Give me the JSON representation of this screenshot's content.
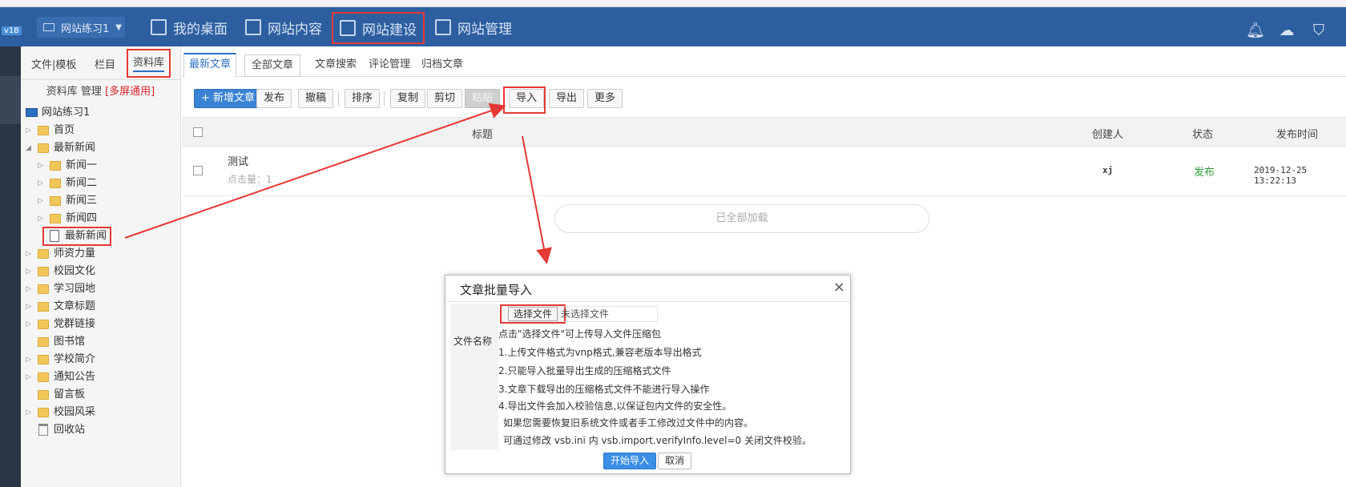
{
  "header": {
    "version_badge": "v18",
    "site_select": "网站练习1",
    "nav": [
      "我的桌面",
      "网站内容",
      "网站建设",
      "网站管理"
    ]
  },
  "sidebar": {
    "tabs": [
      "文件|模板",
      "栏目",
      "资料库"
    ],
    "title": "资料库 管理",
    "title_tag": "[多屏通用]",
    "tree": {
      "root": "网站练习1",
      "home": "首页",
      "latest_news": "最新新闻",
      "news1": "新闻一",
      "news2": "新闻二",
      "news3": "新闻三",
      "news4": "新闻四",
      "latest_news_doc": "最新新闻",
      "teachers": "师资力量",
      "campus_culture": "校园文化",
      "study_garden": "学习园地",
      "article_title": "文章标题",
      "party_links": "党群链接",
      "library": "图书馆",
      "school_intro": "学校简介",
      "notices": "通知公告",
      "guestbook": "留言板",
      "campus_scenery": "校园风采",
      "recycle": "回收站"
    }
  },
  "main": {
    "tabs": [
      "最新文章",
      "全部文章",
      "文章搜索",
      "评论管理",
      "归档文章"
    ],
    "toolbar": {
      "new_article": "+ 新增文章",
      "publish": "发布",
      "withdraw": "撤稿",
      "sort": "排序",
      "copy": "复制",
      "cut": "剪切",
      "paste": "粘贴",
      "import": "导入",
      "export": "导出",
      "more": "更多"
    },
    "table": {
      "headers": {
        "title": "标题",
        "creator": "创建人",
        "status": "状态",
        "publish_time": "发布时间"
      },
      "rows": [
        {
          "title": "测试",
          "clicks": "点击量：1",
          "creator": "xj",
          "status": "发布",
          "publish_time": "2019-12-25 13:22:13"
        }
      ]
    },
    "all_loaded": "已全部加载"
  },
  "dialog": {
    "title": "文章批量导入",
    "close": "×",
    "field_label": "文件名称",
    "choose_file": "选择文件",
    "no_file": "未选择文件",
    "hint": "点击\"选择文件\"可上传导入文件压缩包",
    "lines": [
      "1.上传文件格式为vnp格式,兼容老版本导出格式",
      "2.只能导入批量导出生成的压缩格式文件",
      "3.文章下载导出的压缩格式文件不能进行导入操作",
      "4.导出文件会加入校验信息,以保证包内文件的安全性。",
      "如果您需要恢复旧系统文件或者手工修改过文件中的内容。",
      "可通过修改 vsb.ini 内 vsb.import.verifyInfo.level=0 关闭文件校验。"
    ],
    "start_import": "开始导入",
    "cancel": "取消"
  },
  "colors": {
    "header_bg": "#2d5fa0",
    "annotation_red": "#e53935",
    "primary_blue": "#3a83d4",
    "status_green": "#2e9d3a"
  },
  "icons": [
    "bell-icon",
    "cloud-icon",
    "shirt-icon",
    "folder-icon",
    "document-icon",
    "trash-icon",
    "monitor-icon"
  ]
}
